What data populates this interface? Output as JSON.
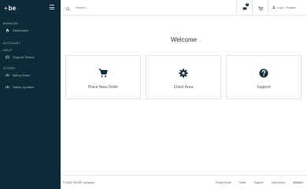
{
  "brand": {
    "logo_mark": "+",
    "logo_text": "be"
  },
  "sidebar": {
    "sections": [
      {
        "title": "MANAGE",
        "items": [
          {
            "label": "Dashboard",
            "icon": "home-icon"
          }
        ]
      },
      {
        "title": "ACCOUNT",
        "items": []
      },
      {
        "title": "HELP",
        "items": [
          {
            "label": "Support Tickets",
            "icon": "ticket-icon"
          }
        ]
      },
      {
        "title": "OTHER",
        "items": [
          {
            "label": "Billing Home",
            "icon": "link-icon"
          },
          {
            "label": "Status Updates",
            "icon": "link-icon"
          }
        ]
      }
    ]
  },
  "topbar": {
    "search_placeholder": "Search...",
    "notification_count": "0",
    "account_label": "Login / Register"
  },
  "main": {
    "welcome": "Welcome",
    "cards": [
      {
        "label": "Place New Order",
        "icon": "cart-icon"
      },
      {
        "label": "Client Area",
        "icon": "gear-icon"
      },
      {
        "label": "Support",
        "icon": "question-icon"
      }
    ]
  },
  "footer": {
    "copyright": "© 2025 The BE Company",
    "links": [
      "Portal Home",
      "Order",
      "Support",
      "Client Area",
      "Affiliates"
    ]
  },
  "colors": {
    "sidebar_bg": "#0d2a38",
    "icon_dark": "#0d2a38"
  }
}
